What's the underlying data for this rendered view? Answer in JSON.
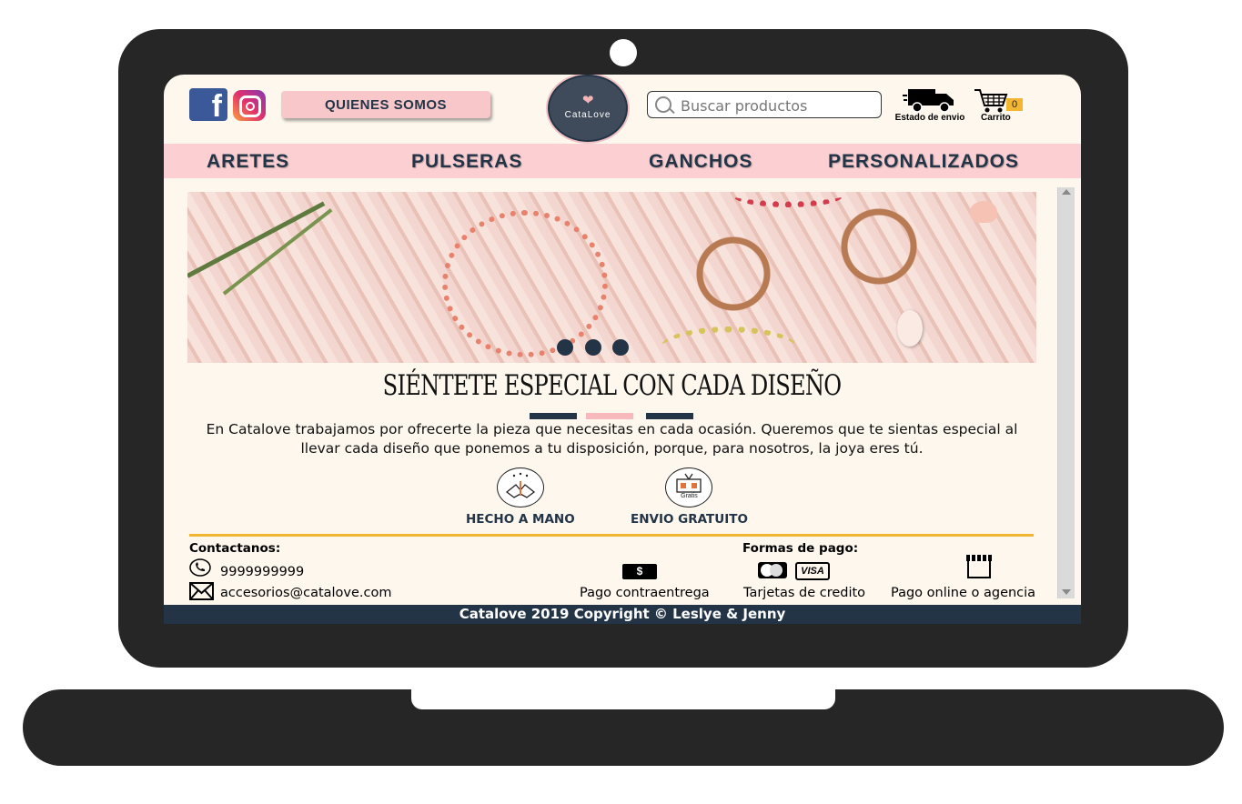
{
  "header": {
    "social": [
      "facebook-icon",
      "instagram-icon"
    ],
    "about_button": "QUIENES SOMOS",
    "logo_text": "CataLove",
    "search_placeholder": "Buscar productos",
    "shipping_status_label": "Estado de envio",
    "cart_label": "Carrito",
    "cart_count": "0"
  },
  "nav": {
    "items": [
      "ARETES",
      "PULSERAS",
      "GANCHOS",
      "PERSONALIZADOS"
    ]
  },
  "hero": {
    "slide_count": 3
  },
  "main": {
    "slogan": "SIÉNTETE ESPECIAL CON CADA DISEÑO",
    "about_text": "En Catalove trabajamos por ofrecerte la pieza que necesitas en cada ocasión. Queremos que te sientas especial al llevar cada diseño que ponemos a tu disposición, porque, para nosotros, la joya eres tú.",
    "features": [
      {
        "icon": "handmade-icon",
        "label": "HECHO A MANO"
      },
      {
        "icon": "free-shipping-icon",
        "label": "ENVIO GRATUITO",
        "badge": "Gratis"
      }
    ]
  },
  "footer": {
    "contact_title": "Contactanos:",
    "phone": "9999999999",
    "email": "accesorios@catalove.com",
    "payment_title": "Formas de pago:",
    "payments": [
      {
        "icon": "cash-icon",
        "symbol": "$",
        "label": "Pago contraentrega"
      },
      {
        "icon": "card-icon",
        "label": "Tarjetas de credito",
        "card_marks": [
          "MasterCard",
          "VISA"
        ]
      },
      {
        "icon": "store-icon",
        "label": "Pago online o agencia"
      }
    ],
    "copyright": "Catalove 2019 Copyright  © Leslye & Jenny"
  },
  "colors": {
    "navy": "#233447",
    "pink": "#fcd0d2",
    "gold": "#f3b633",
    "screen_bg": "#fdf7ee",
    "laptop": "#262626"
  }
}
